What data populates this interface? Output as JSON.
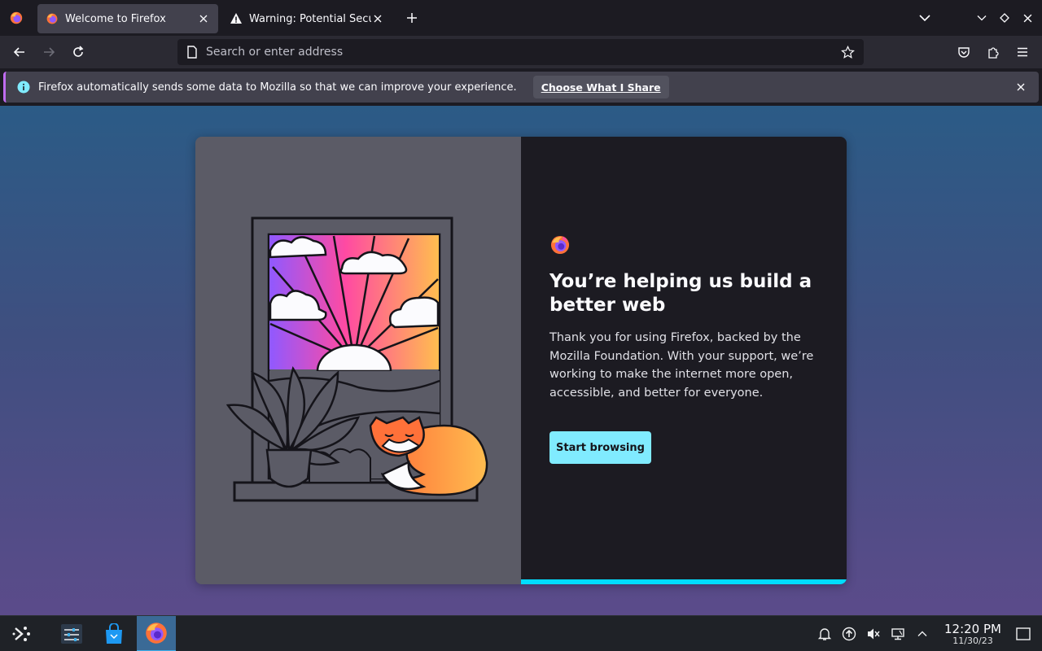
{
  "tabs": [
    {
      "title": "Welcome to Firefox",
      "active": true
    },
    {
      "title": "Warning: Potential Security Risk Ahead",
      "active": false
    }
  ],
  "urlbar": {
    "placeholder": "Search or enter address"
  },
  "notification": {
    "message": "Firefox automatically sends some data to Mozilla so that we can improve your experience.",
    "button_label": "Choose What I Share"
  },
  "welcome": {
    "heading": "You’re helping us build a better web",
    "body": "Thank you for using Firefox, backed by the Mozilla Foundation. With your support, we’re working to make the internet more open, accessible, and better for everyone.",
    "button_label": "Start browsing"
  },
  "taskbar": {
    "time": "12:20 PM",
    "date": "11/30/23"
  },
  "colors": {
    "accent": "#00ddff",
    "button": "#80ebff",
    "taskbar_active": "#3daee9"
  }
}
